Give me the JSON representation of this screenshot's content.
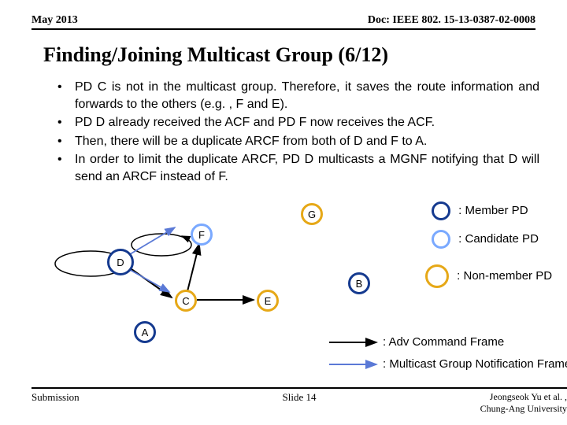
{
  "header": {
    "date": "May 2013",
    "doc": "Doc: IEEE 802. 15-13-0387-02-0008"
  },
  "title": "Finding/Joining Multicast Group (6/12)",
  "bullets": [
    "PD C is not in the multicast group. Therefore, it saves the route information and forwards to the others (e.g. , F and E).",
    "PD D already received the ACF and PD F now receives the ACF.",
    "Then, there will be a duplicate ARCF from both of D and F to A.",
    "In order to limit the duplicate ARCF, PD D multicasts a MGNF notifying that D will send an ARCF instead of F."
  ],
  "nodes": {
    "A": "A",
    "B": "B",
    "C": "C",
    "D": "D",
    "E": "E",
    "F": "F",
    "G": "G"
  },
  "legend": {
    "member": ": Member PD",
    "candidate": ": Candidate PD",
    "nonmember": ": Non-member PD",
    "adv": ": Adv Command Frame",
    "mgnf": ": Multicast Group Notification Frame"
  },
  "footer": {
    "left": "Submission",
    "center": "Slide 14",
    "authors": "Jeongseok Yu et al. ,",
    "affil": "Chung-Ang University"
  }
}
